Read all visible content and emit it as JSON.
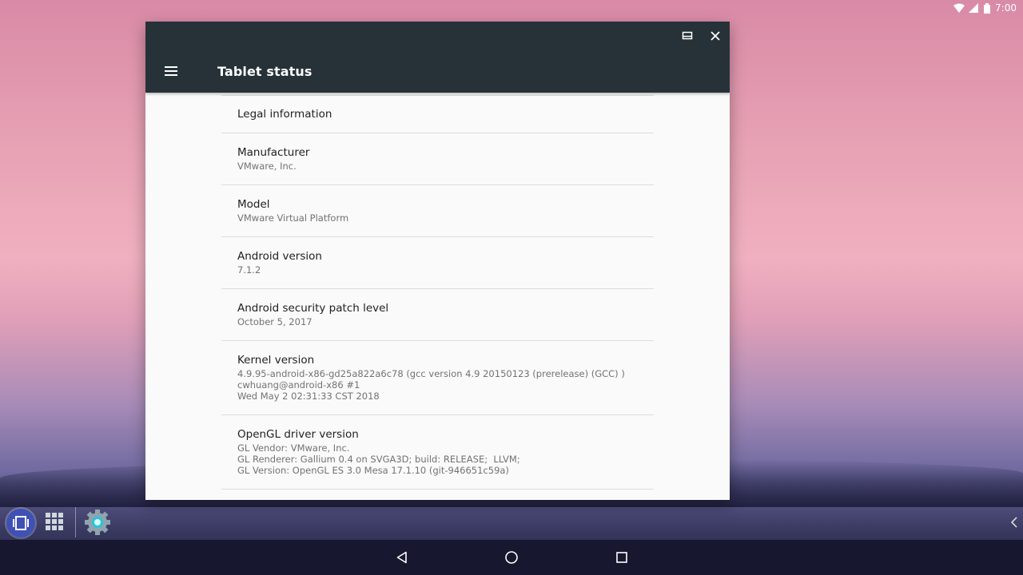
{
  "status_bar": {
    "time": "7:00"
  },
  "window": {
    "appbar_title": "Tablet status"
  },
  "preferences": [
    {
      "title": "Legal information",
      "summary": ""
    },
    {
      "title": "Manufacturer",
      "summary": "VMware, Inc."
    },
    {
      "title": "Model",
      "summary": "VMware Virtual Platform"
    },
    {
      "title": "Android version",
      "summary": "7.1.2"
    },
    {
      "title": "Android security patch level",
      "summary": "October 5, 2017"
    },
    {
      "title": "Kernel version",
      "summary": "4.9.95-android-x86-gd25a822a6c78 (gcc version 4.9 20150123 (prerelease) (GCC) )\ncwhuang@android-x86 #1\nWed May 2 02:31:33 CST 2018"
    },
    {
      "title": "OpenGL driver version",
      "summary": "GL Vendor: VMware, Inc.\nGL Renderer: Gallium 0.4 on SVGA3D; build: RELEASE;  LLVM;\nGL Version: OpenGL ES 3.0 Mesa 17.1.10 (git-946651c59a)"
    }
  ],
  "colors": {
    "appbar": "#263238",
    "window_bg": "#fafafa",
    "taskbar_accent": "#3f51b5"
  }
}
